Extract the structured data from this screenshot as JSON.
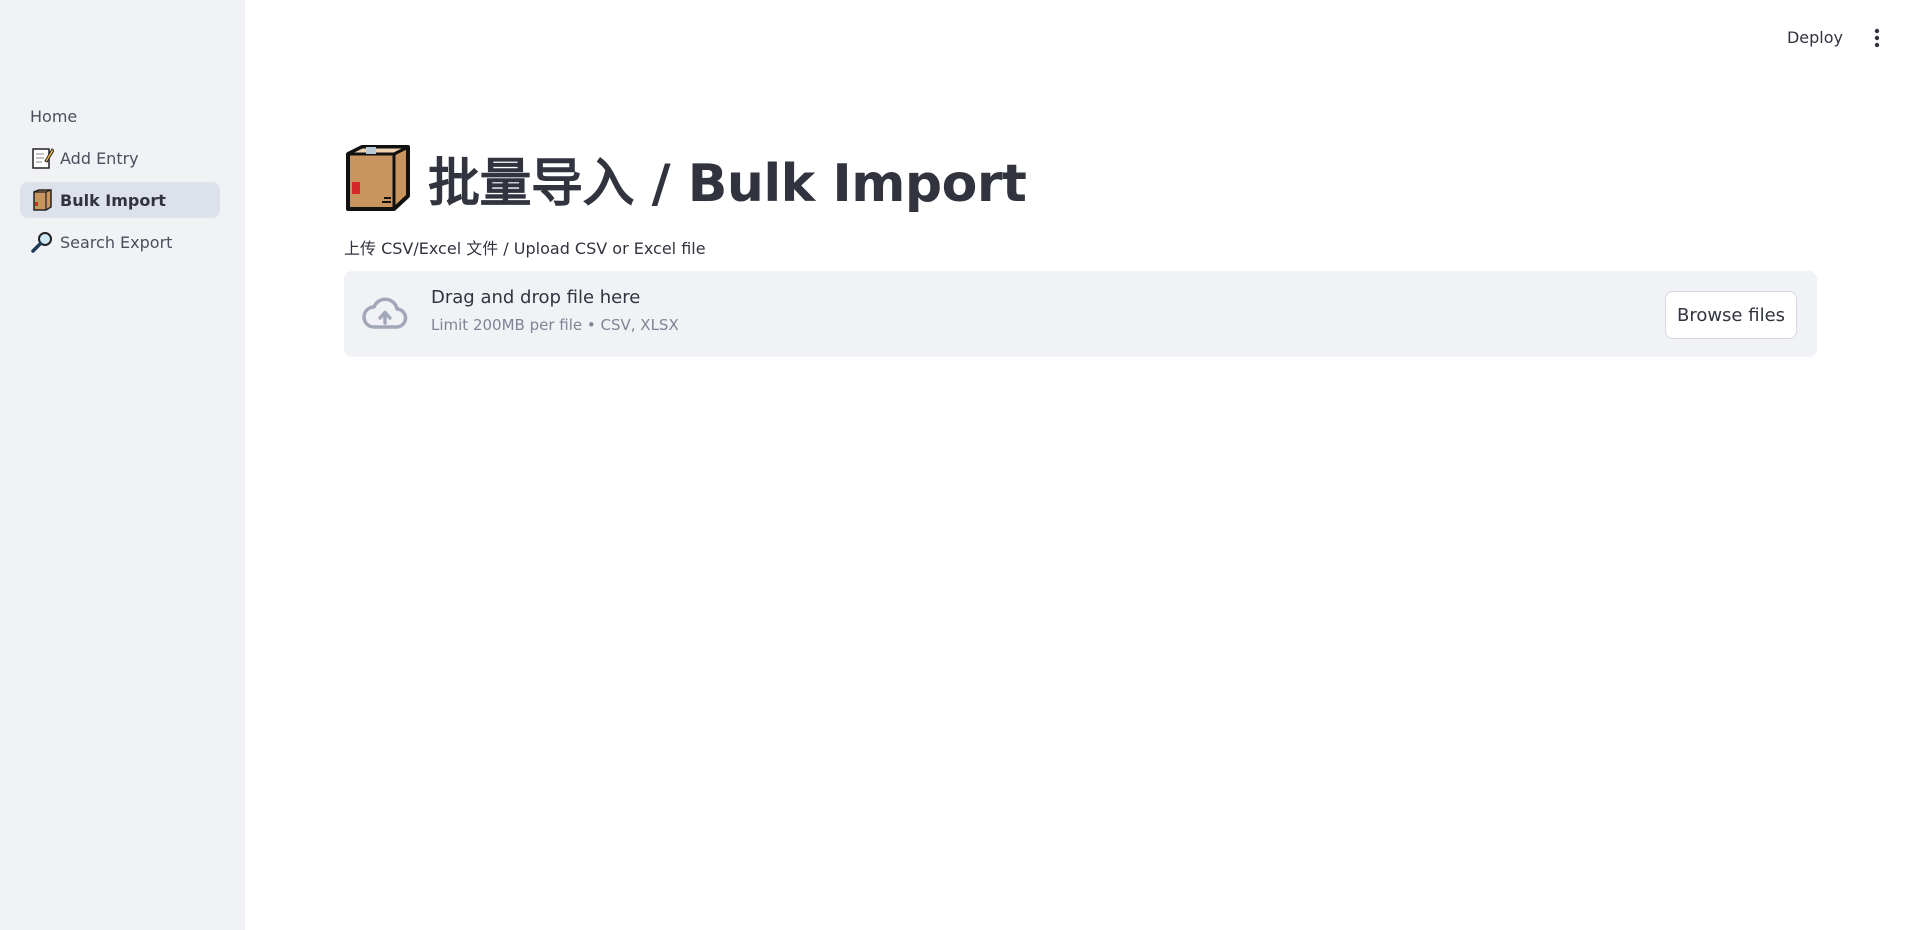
{
  "sidebar": {
    "items": [
      {
        "label": "Home",
        "icon": "",
        "active": false
      },
      {
        "label": "Add Entry",
        "icon": "memo-icon",
        "active": false
      },
      {
        "label": "Bulk Import",
        "icon": "package-icon",
        "active": true
      },
      {
        "label": "Search Export",
        "icon": "magnifier-icon",
        "active": false
      }
    ]
  },
  "header": {
    "deploy_label": "Deploy",
    "menu_icon": "kebab-menu-icon"
  },
  "main": {
    "title": "批量导入 / Bulk Import",
    "title_icon": "package-icon",
    "upload_label": "上传 CSV/Excel 文件 / Upload CSV or Excel file",
    "dropzone": {
      "title": "Drag and drop file here",
      "limit": "Limit 200MB per file • CSV, XLSX",
      "icon": "cloud-upload-icon",
      "browse_label": "Browse files"
    }
  },
  "colors": {
    "sidebar_bg": "#f0f2f6",
    "active_item_bg": "#dde1ea",
    "text": "#31333f",
    "muted_text": "#808495"
  }
}
